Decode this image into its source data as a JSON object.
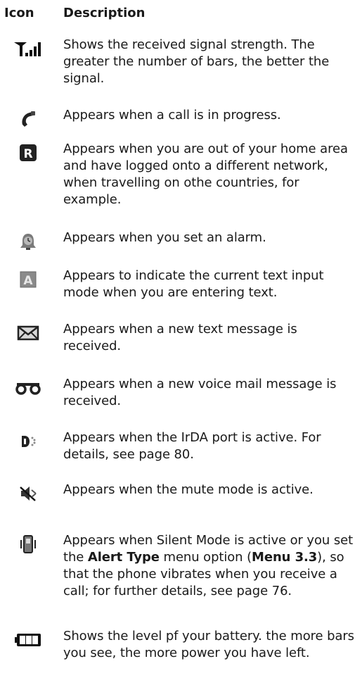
{
  "header": {
    "icon": "Icon",
    "description": "Description"
  },
  "rows": [
    {
      "icon": "signal-strength-icon",
      "text": "Shows the received signal strength. The greater the number of bars, the better the signal."
    },
    {
      "icon": "call-in-progress-icon",
      "text": "Appears when a call is in progress."
    },
    {
      "icon": "roaming-icon",
      "text": "Appears when you are out of your home area and have logged onto a different network, when travelling on othe countries, for example."
    },
    {
      "icon": "alarm-icon",
      "text": "Appears when you set an alarm."
    },
    {
      "icon": "text-input-mode-icon",
      "text": "Appears to indicate the current text input mode when you are entering text."
    },
    {
      "icon": "envelope-icon",
      "text": "Appears when a new text message is received."
    },
    {
      "icon": "voicemail-icon",
      "text": "Appears when a new voice mail message is received."
    },
    {
      "icon": "irda-icon",
      "text": "Appears when the IrDA port is active. For details, see page 80."
    },
    {
      "icon": "mute-icon",
      "text": "Appears when the mute mode is active."
    },
    {
      "icon": "vibrate-icon",
      "text_parts": [
        "Appears when Silent Mode is active or you set the ",
        "Alert Type",
        " menu option (",
        "Menu 3.3",
        "), so that the phone vibrates when you receive a call; for further details, see page 76."
      ]
    },
    {
      "icon": "battery-icon",
      "text": "Shows the level pf your battery. the more bars you see, the more power you have left."
    }
  ]
}
